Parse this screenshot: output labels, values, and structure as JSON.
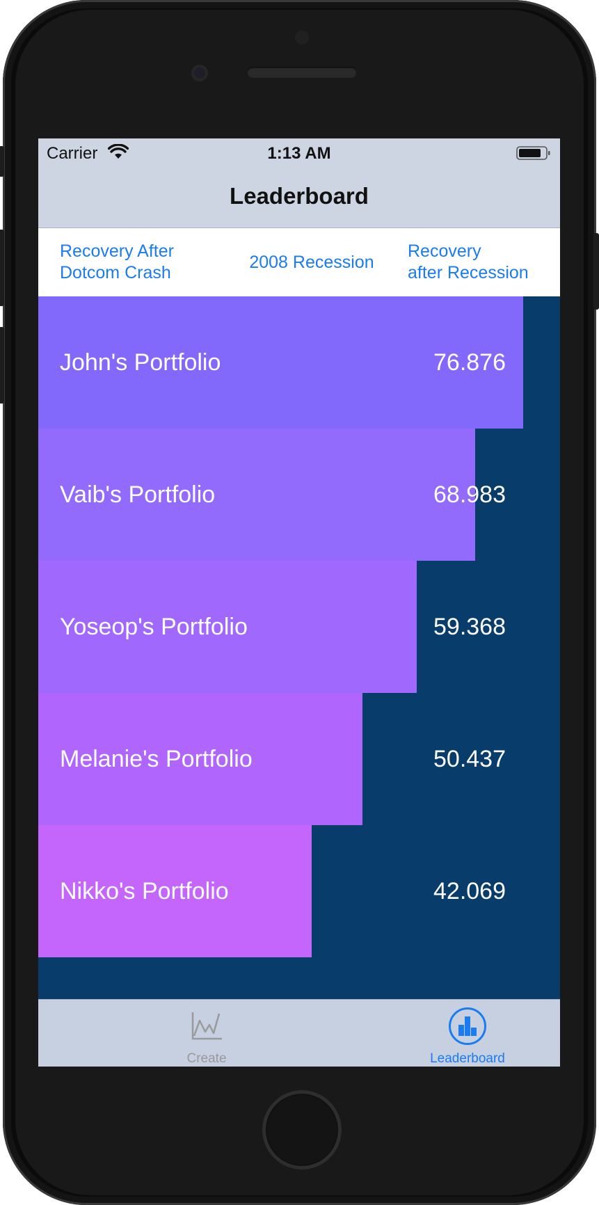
{
  "status_bar": {
    "carrier": "Carrier",
    "time": "1:13 AM"
  },
  "nav": {
    "title": "Leaderboard"
  },
  "segments": [
    {
      "label": "Recovery After\nDotcom Crash"
    },
    {
      "label": "2008 Recession"
    },
    {
      "label": "Recovery\nafter Recession"
    }
  ],
  "leaderboard": [
    {
      "name": "John's Portfolio",
      "score": "76.876",
      "bar_color": "#8269fb"
    },
    {
      "name": "Vaib's Portfolio",
      "score": "68.983",
      "bar_color": "#926afc"
    },
    {
      "name": "Yoseop's Portfolio",
      "score": "59.368",
      "bar_color": "#a068fc"
    },
    {
      "name": "Melanie's Portfolio",
      "score": "50.437",
      "bar_color": "#b066fc"
    },
    {
      "name": "Nikko's Portfolio",
      "score": "42.069",
      "bar_color": "#c466fc"
    }
  ],
  "tabs": [
    {
      "label": "Create",
      "icon": "line-chart-icon",
      "selected": false
    },
    {
      "label": "Leaderboard",
      "icon": "bar-chart-icon",
      "selected": true
    }
  ],
  "colors": {
    "accent": "#1a7cf0",
    "board_background": "#083d6b",
    "bar_gradient_start": "#7d6cfb",
    "bar_gradient_end": "#c865fd"
  }
}
